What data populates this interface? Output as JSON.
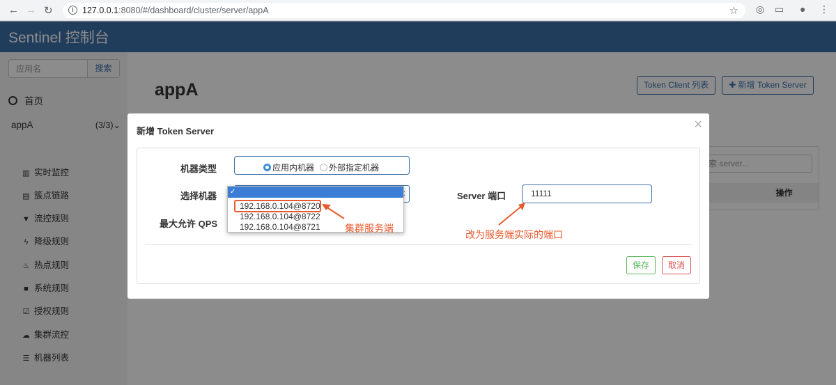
{
  "browser": {
    "url_host": "127.0.0.1",
    "url_rest": ":8080/#/dashboard/cluster/server/appA"
  },
  "app": {
    "brand": "Sentinel 控制台",
    "search": {
      "placeholder": "应用名",
      "button": "搜索"
    },
    "home_label": "首页",
    "app_name": "appA",
    "app_count": "(3/3)",
    "menu": [
      {
        "label": "实时监控",
        "icon": "chart-icon"
      },
      {
        "label": "簇点链路",
        "icon": "list-icon"
      },
      {
        "label": "流控规则",
        "icon": "filter-icon"
      },
      {
        "label": "降级规则",
        "icon": "bolt-icon"
      },
      {
        "label": "热点规则",
        "icon": "fire-icon"
      },
      {
        "label": "系统规则",
        "icon": "lock-icon"
      },
      {
        "label": "授权规则",
        "icon": "check-icon"
      },
      {
        "label": "集群流控",
        "icon": "cloud-icon"
      },
      {
        "label": "机器列表",
        "icon": "list-icon"
      }
    ]
  },
  "main": {
    "title": "appA",
    "token_client_button": "Token Client 列表",
    "add_server_button": "新增 Token Server",
    "panel_search_placeholder": "索 server...",
    "panel_header": "操作"
  },
  "modal": {
    "title": "新增 Token Server",
    "machine_type_label": "机器类型",
    "machine_type_options": [
      "应用内机器",
      "外部指定机器"
    ],
    "machine_type_selected": "应用内机器",
    "select_machine_label": "选择机器",
    "machine_options": [
      "192.168.0.104@8720",
      "192.168.0.104@8722",
      "192.168.0.104@8721"
    ],
    "max_qps_label": "最大允许 QPS",
    "server_port_label": "Server 端口",
    "server_port_value": "11111",
    "save_button": "保存",
    "cancel_button": "取消"
  },
  "annotations": {
    "cluster_server": "集群服务端",
    "change_port": "改为服务端实际的端口"
  },
  "colors": {
    "brand": "#3c6fa8",
    "annotation": "#e8592c",
    "save": "#5cb85c",
    "cancel": "#d9534f"
  }
}
